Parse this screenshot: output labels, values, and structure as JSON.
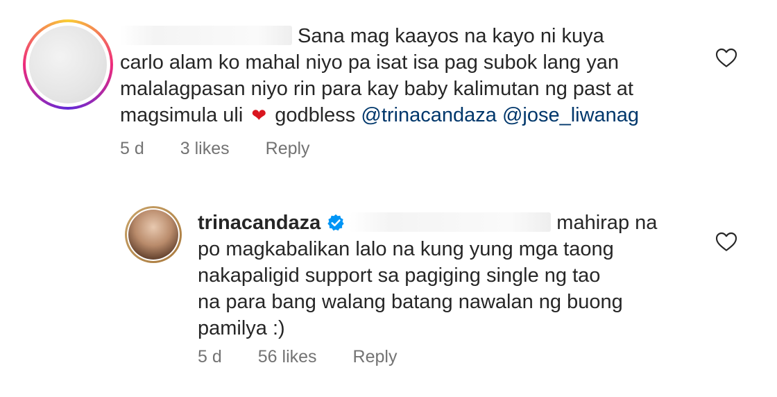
{
  "comments": [
    {
      "username": "",
      "text_part1": "Sana mag kaayos na kayo ni kuya",
      "line2": "carlo alam ko mahal niyo pa isat isa pag subok lang yan",
      "line3": "malalagpasan niyo rin para kay baby kalimutan ng past at",
      "line4_start": "magsimula uli",
      "heart_emoji": "❤",
      "line4_mid": "godbless",
      "mention1": "@trinacandaza",
      "mention2": "@jose_liwanag",
      "time": "5 d",
      "likes": "3 likes",
      "reply": "Reply"
    },
    {
      "username": "trinacandaza",
      "text_part1": "mahirap na",
      "line2": "po magkabalikan lalo na kung yung mga taong",
      "line3": "nakapaligid support sa pagiging single ng tao",
      "line4": "na para bang walang batang nawalan ng buong",
      "line5": "pamilya :)",
      "time": "5 d",
      "likes": "56 likes",
      "reply": "Reply"
    }
  ],
  "colors": {
    "text": "#262626",
    "muted": "#737373",
    "mention": "#00376b",
    "verified": "#0095f6",
    "heart": "#d9161f"
  },
  "icons": {
    "like": "heart-outline-icon",
    "verified": "verified-badge-icon"
  }
}
